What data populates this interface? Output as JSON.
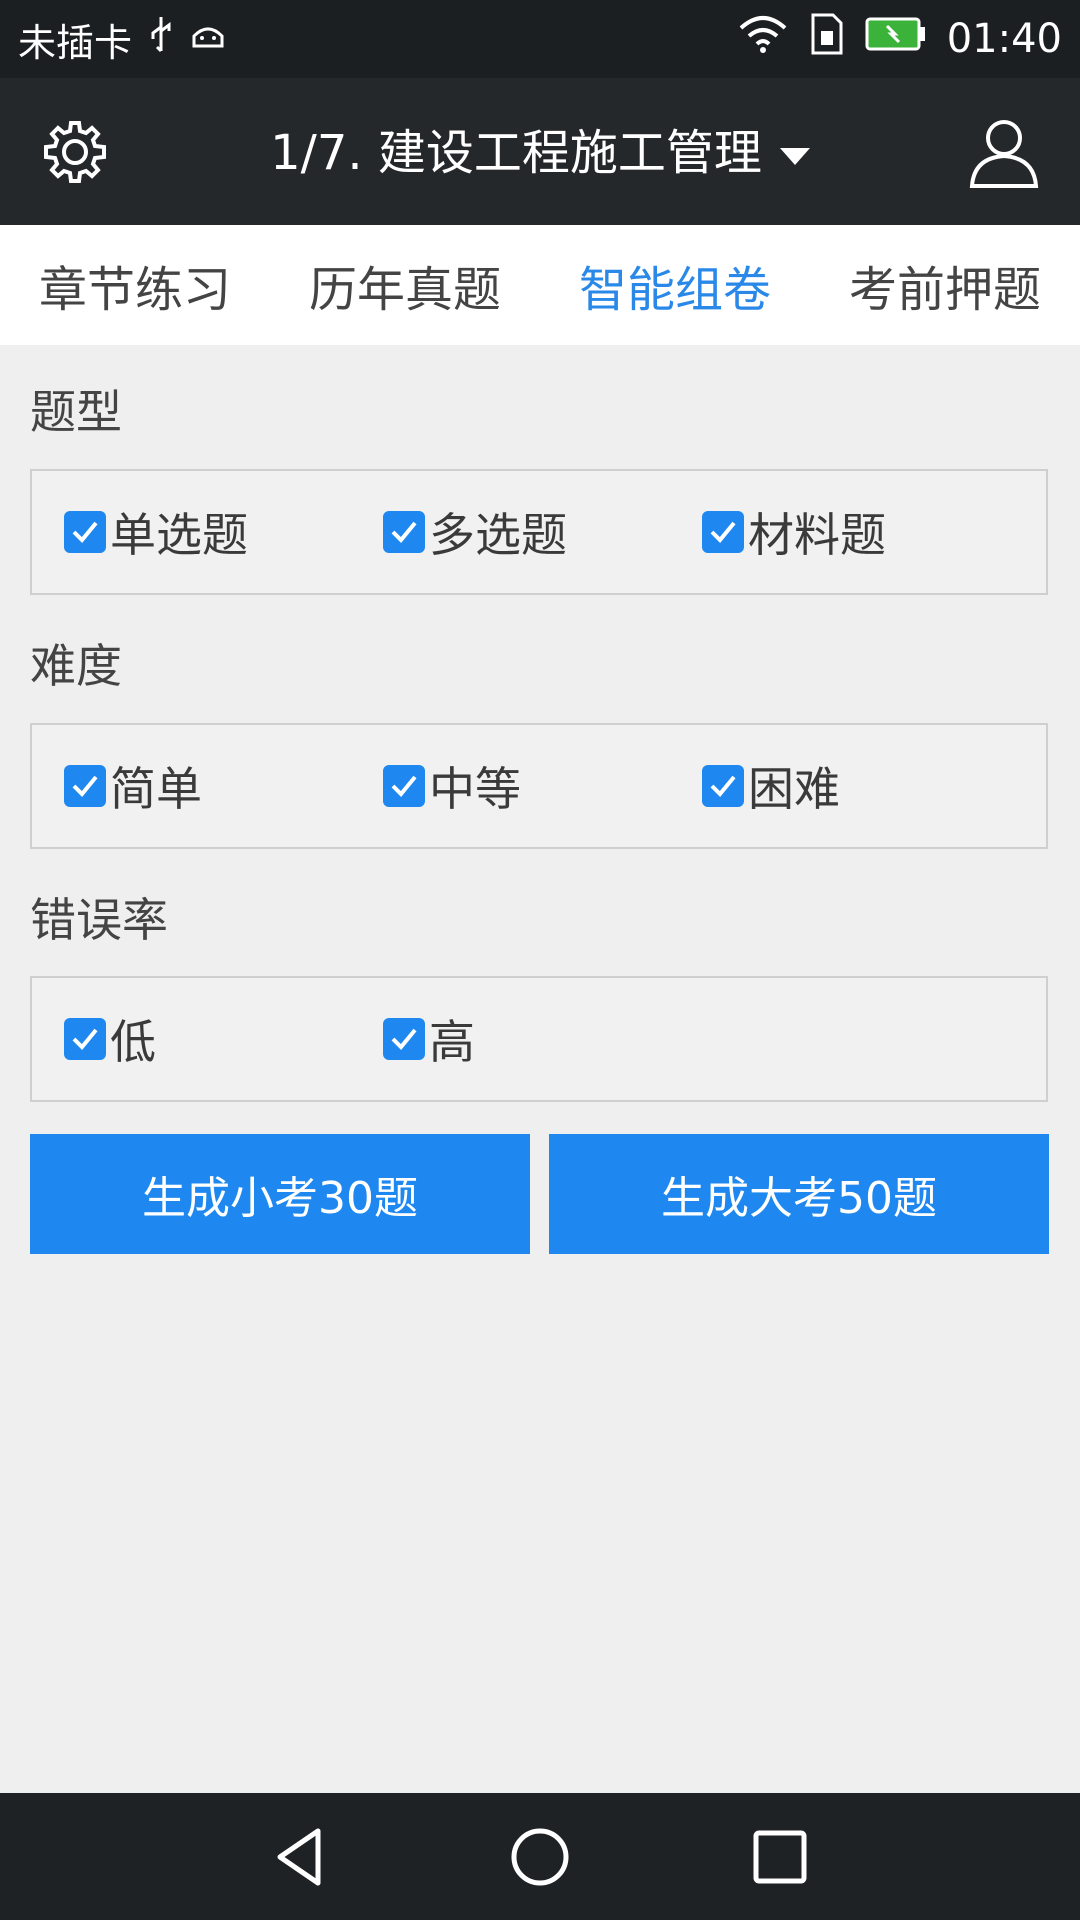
{
  "status": {
    "carrier": "未插卡",
    "time": "01:40"
  },
  "appbar": {
    "title": "1/7. 建设工程施工管理"
  },
  "tabs": [
    {
      "label": "章节练习"
    },
    {
      "label": "历年真题"
    },
    {
      "label": "智能组卷"
    },
    {
      "label": "考前押题"
    }
  ],
  "sections": {
    "type": {
      "label": "题型",
      "options": [
        {
          "label": "单选题",
          "checked": true
        },
        {
          "label": "多选题",
          "checked": true
        },
        {
          "label": "材料题",
          "checked": true
        }
      ]
    },
    "difficulty": {
      "label": "难度",
      "options": [
        {
          "label": "简单",
          "checked": true
        },
        {
          "label": "中等",
          "checked": true
        },
        {
          "label": "困难",
          "checked": true
        }
      ]
    },
    "error_rate": {
      "label": "错误率",
      "options": [
        {
          "label": "低",
          "checked": true
        },
        {
          "label": "高",
          "checked": true
        }
      ]
    }
  },
  "buttons": {
    "small": "生成小考30题",
    "large": "生成大考50题"
  },
  "colors": {
    "accent": "#1e88f0",
    "active_tab": "#2a89e8",
    "appbar": "#25282b"
  }
}
